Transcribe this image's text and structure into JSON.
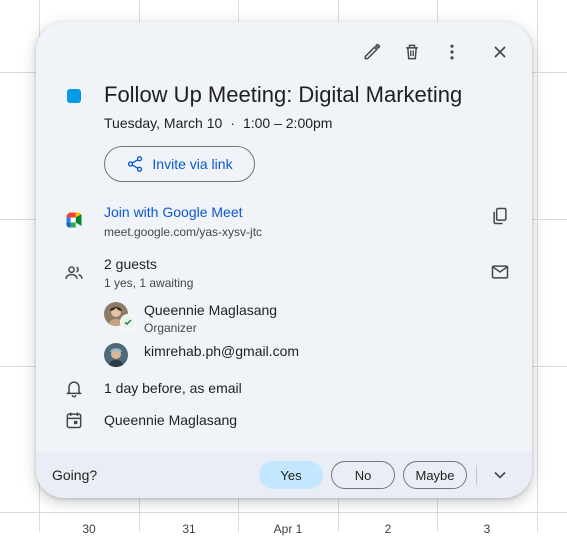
{
  "background_calendar": {
    "bottom_dates": [
      "30",
      "31",
      "Apr 1",
      "2",
      "3"
    ]
  },
  "toolbar": {
    "icons": [
      "edit-icon",
      "delete-icon",
      "more-options-icon",
      "close-icon"
    ]
  },
  "event": {
    "color": "#039be5",
    "title": "Follow Up Meeting: Digital Marketing",
    "date": "Tuesday, March 10",
    "separator": "·",
    "time": "1:00 – 2:00pm",
    "invite_label": "Invite via link"
  },
  "meet": {
    "join_label": "Join with Google Meet",
    "url": "meet.google.com/yas-xysv-jtc"
  },
  "guests": {
    "count_label": "2 guests",
    "status_label": "1 yes, 1 awaiting",
    "list": [
      {
        "name": "Queennie Maglasang",
        "role": "Organizer"
      },
      {
        "name": "kimrehab.ph@gmail.com",
        "role": ""
      }
    ]
  },
  "reminder": "1 day before, as email",
  "calendar_owner": "Queennie Maglasang",
  "rsvp": {
    "prompt": "Going?",
    "yes": "Yes",
    "no": "No",
    "maybe": "Maybe",
    "selected": "Yes"
  },
  "colors": {
    "accent": "#0b57d0",
    "card_bg": "#f0f4f9",
    "selected_rsvp": "#c2e7ff"
  }
}
